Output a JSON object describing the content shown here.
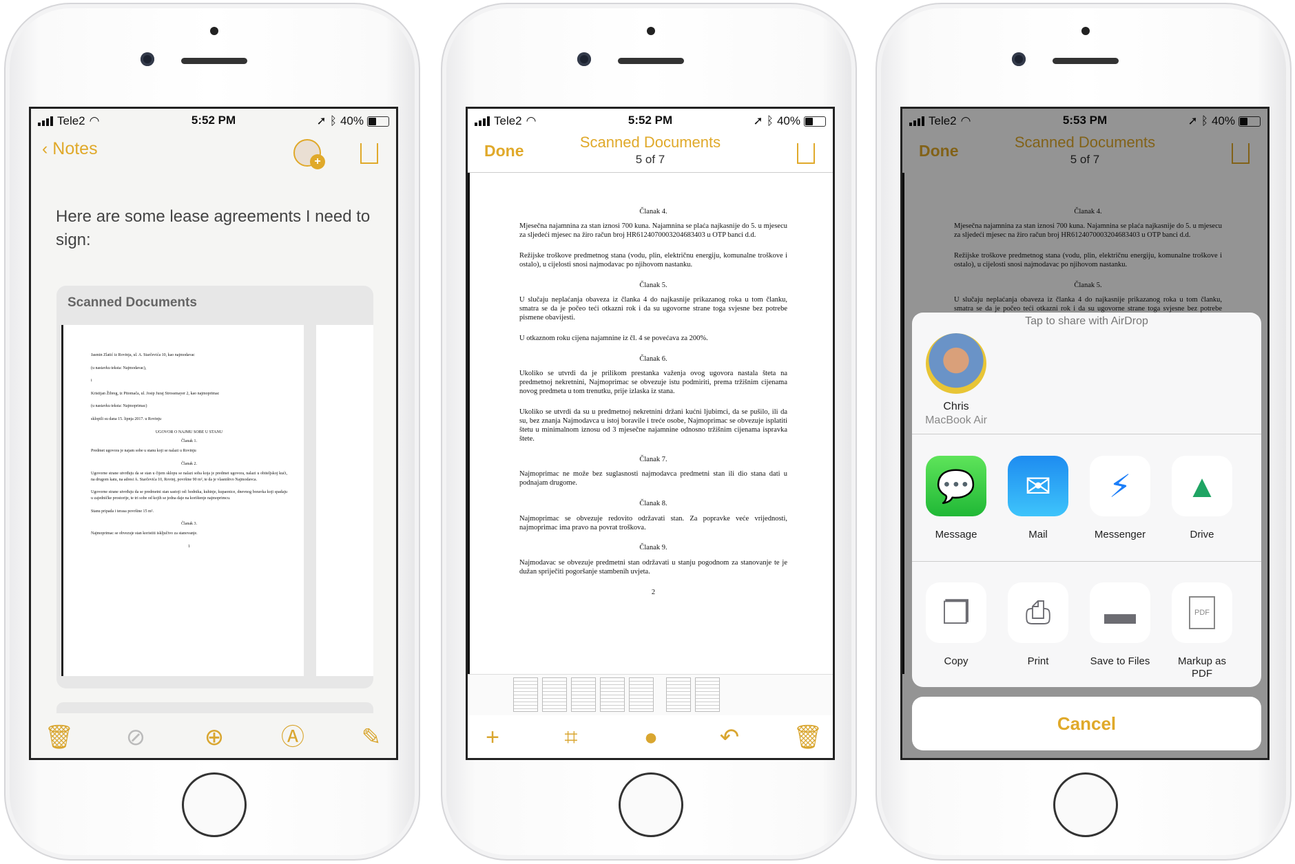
{
  "status": [
    {
      "carrier": "Tele2",
      "time": "5:52 PM",
      "battery": "40%",
      "battery_level": 0.4
    },
    {
      "carrier": "Tele2",
      "time": "5:52 PM",
      "battery": "40%",
      "battery_level": 0.4
    },
    {
      "carrier": "Tele2",
      "time": "5:53 PM",
      "battery": "40%",
      "battery_level": 0.4
    }
  ],
  "colors": {
    "accent": "#e0a92a"
  },
  "note": {
    "back_label": "Notes",
    "body": "Here are some lease agreements I need to sign:",
    "card_title": "Scanned Documents",
    "page1": [
      {
        "t": "p",
        "x": "Jasmin Zlatić iz Rovinja, ul. A. Starčevića 10, kao najmodavac"
      },
      {
        "t": "p",
        "x": "(u nastavku teksta: Najmodavac),"
      },
      {
        "t": "p",
        "x": "i"
      },
      {
        "t": "p",
        "x": "Kristijan Žibreg, iz Pitomača, ul. Josip Juraj Strossmayer 2, kao najmoprimac"
      },
      {
        "t": "p",
        "x": "(u nastavku teksta: Najmoprimac)"
      },
      {
        "t": "p",
        "x": "sklopili su dana 15. lipnja 2017. u Rovinju"
      },
      {
        "t": "h",
        "x": "UGOVOR O NAJMU SOBE U STANU"
      },
      {
        "t": "h",
        "x": "Članak 1."
      },
      {
        "t": "p",
        "x": "Predmet ugovora je najam sobe u stanu koji se nalazi u Rovinju"
      },
      {
        "t": "h",
        "x": "Članak 2."
      },
      {
        "t": "p",
        "x": "Ugovorne strane utvrđuju da se stan u čijem sklopu se nalazi soba koja je predmet ugovora, nalazi u obiteljskoj kući, na drugom katu, na adresi A. Starčevića 10, Rovinj, površine 90 m², te da je vlasništvo Najmodavca."
      },
      {
        "t": "p",
        "x": "Ugovorne strane utvrđuju da se predmetni stan sastoji od: hodnika, kuhinje, kupaonice, dnevnog boravka koji spadaju u zajedničke prostorije, te tri sobe od kojih se jedna daje na korištenje najmoprimcu."
      },
      {
        "t": "p",
        "x": "Stanu pripada i terasa površine 15 m²."
      },
      {
        "t": "h",
        "x": "Članak 3."
      },
      {
        "t": "p",
        "x": "Najmoprimac se obvezuje stan koristiti isključivo za stanovanje."
      },
      {
        "t": "h",
        "x": "1"
      }
    ]
  },
  "viewer": {
    "done_label": "Done",
    "title": "Scanned Documents",
    "subtitle": "5 of 7",
    "page": [
      {
        "t": "h",
        "x": "Članak 4."
      },
      {
        "t": "p",
        "x": "Mjesečna najamnina za stan iznosi 700 kuna. Najamnina se plaća najkasnije do 5. u mjesecu za sljedeći mjesec na žiro račun broj HR6124070003204683403 u OTP banci d.d."
      },
      {
        "t": "p",
        "x": "Režijske troškove predmetnog stana (vodu, plin, električnu energiju, komunalne troškove i ostalo), u cijelosti snosi najmodavac po njihovom nastanku."
      },
      {
        "t": "h",
        "x": "Članak 5."
      },
      {
        "t": "p",
        "x": "U slučaju neplaćanja obaveza iz članka 4 do najkasnije prikazanog roka u tom članku, smatra se da je počeo teći otkazni rok i da su ugovorne strane toga svjesne bez potrebe pismene obavijesti."
      },
      {
        "t": "p",
        "x": "U otkaznom roku cijena najamnine iz čl. 4 se povećava za 200%."
      },
      {
        "t": "h",
        "x": "Članak 6."
      },
      {
        "t": "p",
        "x": "Ukoliko se utvrdi da je prilikom prestanka važenja ovog ugovora nastala šteta na predmetnoj nekretnini, Najmoprimac se obvezuje istu podmiriti, prema tržišnim cijenama novog predmeta u tom trenutku, prije izlaska iz stana."
      },
      {
        "t": "p",
        "x": "Ukoliko se utvrdi da su u predmetnoj nekretnini držani kućni ljubimci, da se pušilo, ili da su, bez znanja Najmodavca u istoj boravile i treće osobe, Najmoprimac se obvezuje isplatiti štetu u minimalnom iznosu od 3 mjesečne najamnine odnosno tržišnim cijenama ispravka štete."
      },
      {
        "t": "h",
        "x": "Članak 7."
      },
      {
        "t": "p",
        "x": "Najmoprimac ne može bez suglasnosti najmodavca predmetni stan ili dio stana dati u podnajam drugome."
      },
      {
        "t": "h",
        "x": "Članak 8."
      },
      {
        "t": "p",
        "x": "Najmoprimac se obvezuje redovito održavati stan. Za popravke veće vrijednosti, najmoprimac ima pravo na povrat troškova."
      },
      {
        "t": "h",
        "x": "Članak 9."
      },
      {
        "t": "p",
        "x": "Najmodavac se obvezuje predmetni stan održavati u stanju pogodnom za stanovanje te je dužan spriječiti pogoršanje stambenih uvjeta."
      },
      {
        "t": "h",
        "x": "2"
      }
    ],
    "done_label_3": "Done",
    "title_3": "Scanned Documents",
    "subtitle_3": "5 of 7"
  },
  "share": {
    "airdrop_label": "Tap to share with AirDrop",
    "contact_name": "Chris",
    "contact_device": "MacBook Air",
    "apps": [
      {
        "label": "Message",
        "icon": "messages-icon"
      },
      {
        "label": "Mail",
        "icon": "mail-icon"
      },
      {
        "label": "Messenger",
        "icon": "messenger-icon"
      },
      {
        "label": "Drive",
        "icon": "google-drive-icon"
      }
    ],
    "actions": [
      {
        "label": "Copy",
        "icon": "copy-icon"
      },
      {
        "label": "Print",
        "icon": "print-icon"
      },
      {
        "label": "Save to Files",
        "icon": "folder-icon"
      },
      {
        "label": "Markup as PDF",
        "icon": "pdf-icon",
        "badge": "PDF"
      }
    ],
    "cancel_label": "Cancel"
  }
}
